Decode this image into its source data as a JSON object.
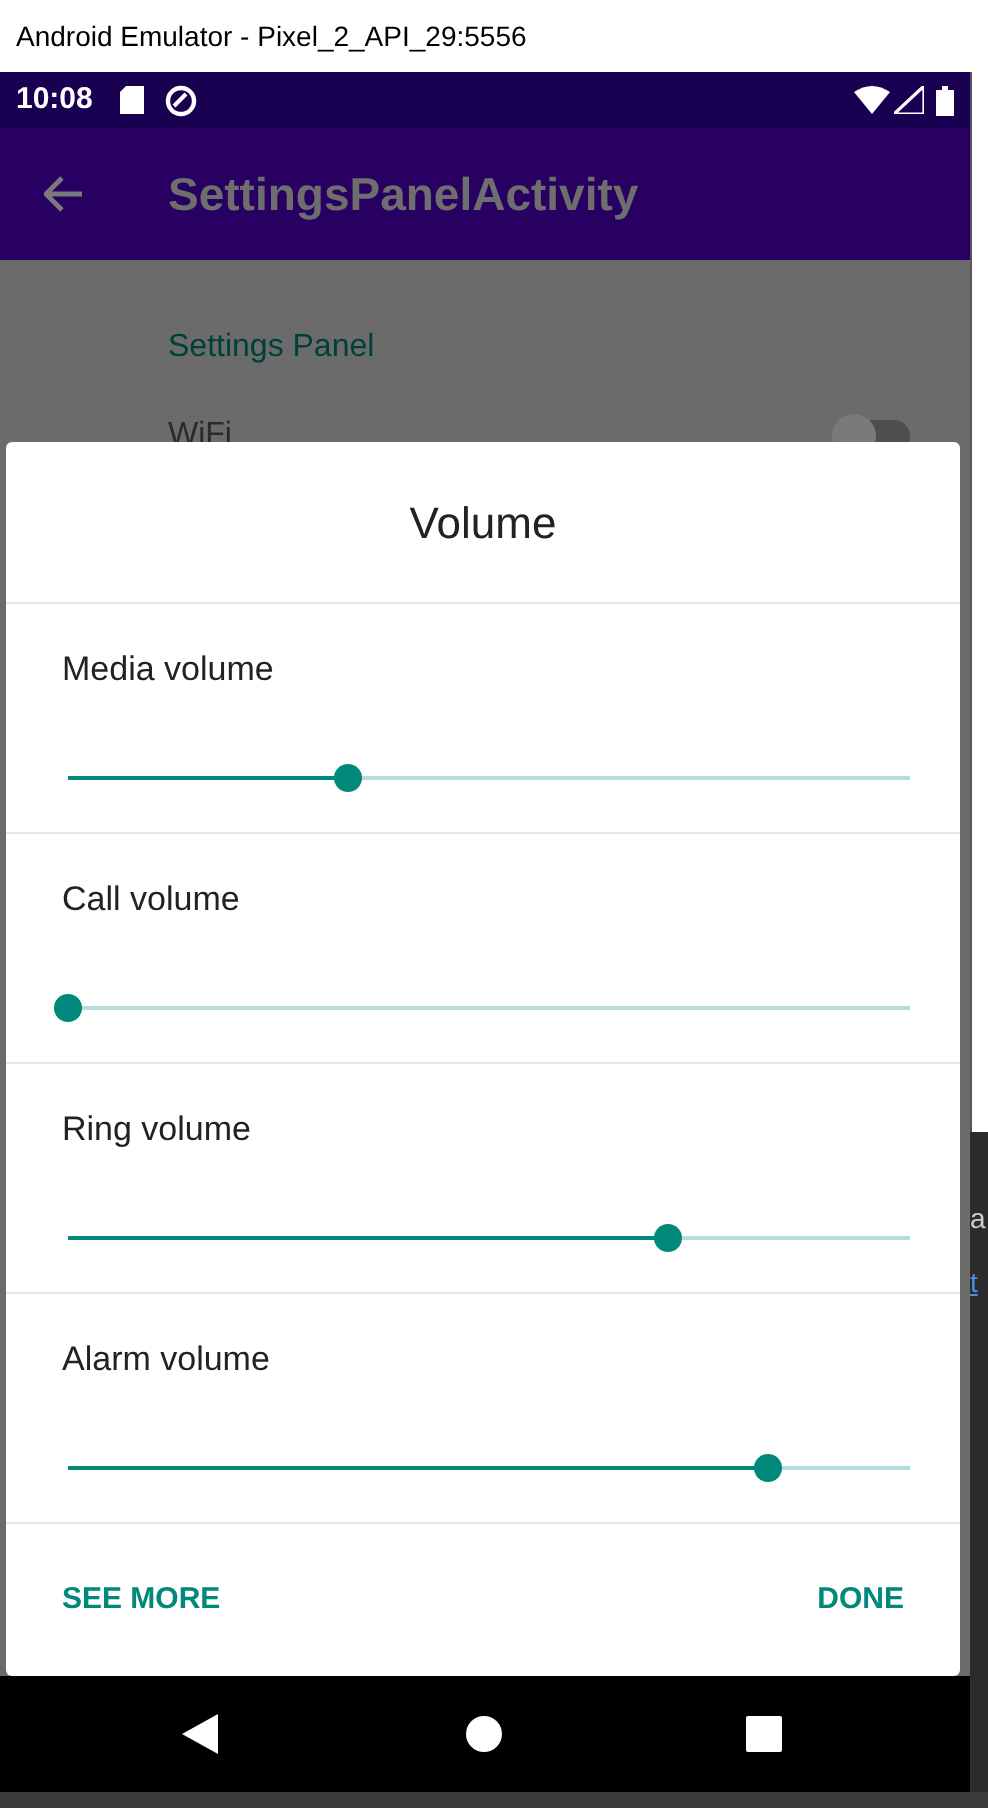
{
  "window": {
    "title": "Android Emulator - Pixel_2_API_29:5556"
  },
  "status_bar": {
    "time": "10:08"
  },
  "app_bar": {
    "title": "SettingsPanelActivity"
  },
  "content": {
    "section_header": "Settings Panel",
    "wifi_label": "WiFi",
    "wifi_switch": {
      "on": false
    }
  },
  "dialog": {
    "title": "Volume",
    "sliders": [
      {
        "label": "Media volume",
        "level": 0.333
      },
      {
        "label": "Call volume",
        "level": 0
      },
      {
        "label": "Ring volume",
        "level": 0.713
      },
      {
        "label": "Alarm volume",
        "level": 0.831
      }
    ],
    "buttons": [
      "SEE MORE",
      "DONE"
    ]
  },
  "background_window": {
    "fragments": [
      "a",
      "t"
    ]
  }
}
